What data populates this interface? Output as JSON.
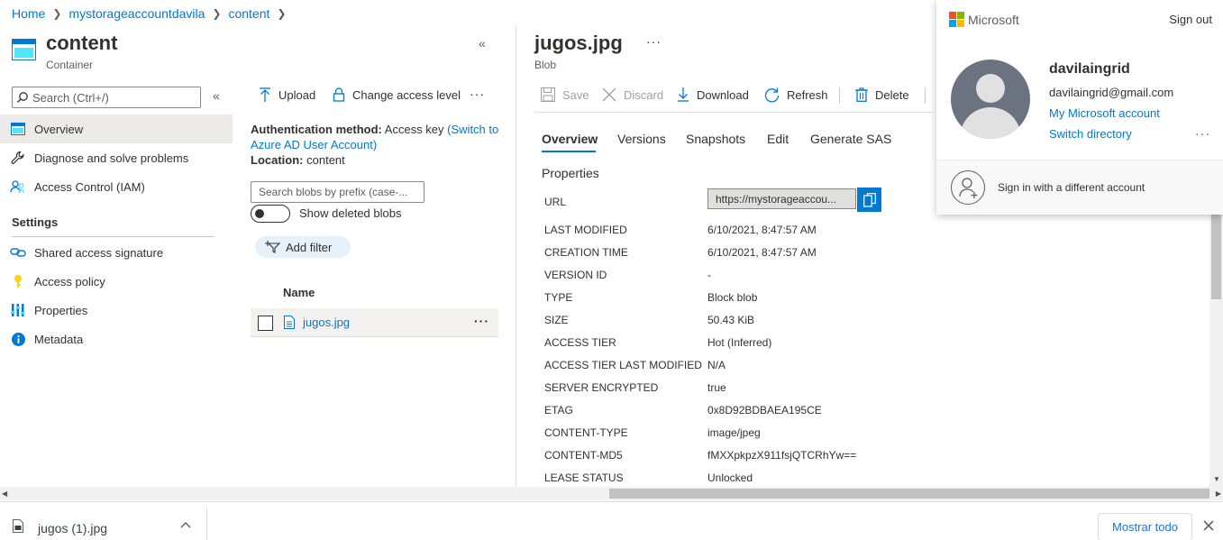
{
  "breadcrumb": [
    "Home",
    "mystorageaccountdavila",
    "content"
  ],
  "left_blade": {
    "title": "content",
    "subtitle": "Container",
    "search_placeholder": "Search (Ctrl+/)",
    "items": [
      {
        "label": "Overview",
        "icon": "overview-icon",
        "selected": true
      },
      {
        "label": "Diagnose and solve problems",
        "icon": "wrench-icon"
      },
      {
        "label": "Access Control (IAM)",
        "icon": "people-icon"
      }
    ],
    "settings_heading": "Settings",
    "settings_items": [
      {
        "label": "Shared access signature",
        "icon": "link-icon"
      },
      {
        "label": "Access policy",
        "icon": "key-icon"
      },
      {
        "label": "Properties",
        "icon": "properties-icon"
      },
      {
        "label": "Metadata",
        "icon": "info-icon"
      }
    ]
  },
  "container_pane": {
    "toolbar": {
      "upload": "Upload",
      "change_access": "Change access level",
      "more": "···"
    },
    "auth_label": "Authentication method:",
    "auth_value": "Access key",
    "auth_switch_line1": "(Switch to",
    "auth_switch_line2": "Azure AD User Account)",
    "location_label": "Location:",
    "location_value": "content",
    "search_blobs_placeholder": "Search blobs by prefix (case-...",
    "show_deleted": "Show deleted blobs",
    "add_filter": "Add filter",
    "column_name": "Name",
    "blobs": [
      {
        "name": "jugos.jpg",
        "more": "···"
      }
    ]
  },
  "blob_pane": {
    "title": "jugos.jpg",
    "subtitle": "Blob",
    "more": "···",
    "toolbar": {
      "save": "Save",
      "discard": "Discard",
      "download": "Download",
      "refresh": "Refresh",
      "delete": "Delete"
    },
    "tabs": [
      "Overview",
      "Versions",
      "Snapshots",
      "Edit",
      "Generate SAS"
    ],
    "properties_heading": "Properties",
    "url_label": "URL",
    "url_value": "https://mystorageaccou...",
    "properties": [
      {
        "key": "LAST MODIFIED",
        "value": "6/10/2021, 8:47:57 AM"
      },
      {
        "key": "CREATION TIME",
        "value": "6/10/2021, 8:47:57 AM"
      },
      {
        "key": "VERSION ID",
        "value": "-"
      },
      {
        "key": "TYPE",
        "value": "Block blob"
      },
      {
        "key": "SIZE",
        "value": "50.43 KiB"
      },
      {
        "key": "ACCESS TIER",
        "value": "Hot (Inferred)"
      },
      {
        "key": "ACCESS TIER LAST MODIFIED",
        "value": "N/A"
      },
      {
        "key": "SERVER ENCRYPTED",
        "value": "true"
      },
      {
        "key": "ETAG",
        "value": "0x8D92BDBAEA195CE"
      },
      {
        "key": "CONTENT-TYPE",
        "value": "image/jpeg"
      },
      {
        "key": "CONTENT-MD5",
        "value": "fMXXpkpzX911fsjQTCRhYw=="
      },
      {
        "key": "LEASE STATUS",
        "value": "Unlocked"
      }
    ]
  },
  "account_popup": {
    "brand": "Microsoft",
    "sign_out": "Sign out",
    "name": "davilaingrid",
    "email": "davilaingrid@gmail.com",
    "my_account": "My Microsoft account",
    "switch_directory": "Switch directory",
    "more": "···",
    "sign_in_other": "Sign in with a different account"
  },
  "download_bar": {
    "file": "jugos (1).jpg",
    "show_all": "Mostrar todo"
  },
  "colors": {
    "accent": "#0078d4",
    "selected_bg": "#edebe9",
    "blob_row_bg": "#f3f2f1"
  }
}
